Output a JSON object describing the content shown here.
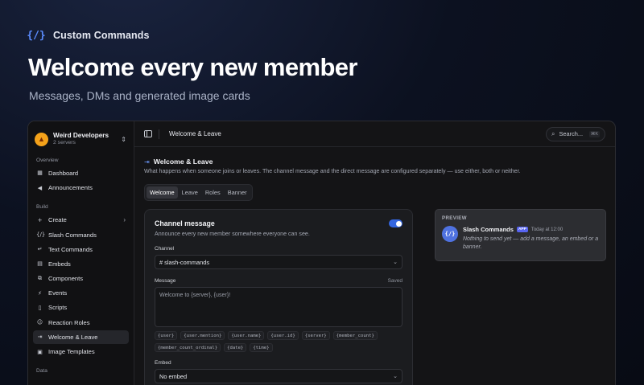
{
  "brand": {
    "name": "Custom Commands",
    "icon": "code-braces-icon"
  },
  "hero": {
    "title": "Welcome every new member",
    "subtitle": "Messages, DMs and generated image cards"
  },
  "workspace": {
    "name": "Weird Developers",
    "count": "2 servers"
  },
  "sidebar": {
    "overview_label": "Overview",
    "overview": [
      {
        "label": "Dashboard",
        "icon": "dashboard-icon"
      },
      {
        "label": "Announcements",
        "icon": "megaphone-icon"
      }
    ],
    "build_label": "Build",
    "build": [
      {
        "label": "Create",
        "icon": "plus-icon"
      },
      {
        "label": "Slash Commands",
        "icon": "slash-braces-icon"
      },
      {
        "label": "Text Commands",
        "icon": "text-command-icon"
      },
      {
        "label": "Embeds",
        "icon": "embed-icon"
      },
      {
        "label": "Components",
        "icon": "components-icon"
      },
      {
        "label": "Events",
        "icon": "bolt-icon"
      },
      {
        "label": "Scripts",
        "icon": "script-icon"
      },
      {
        "label": "Reaction Roles",
        "icon": "reaction-icon"
      },
      {
        "label": "Welcome & Leave",
        "icon": "welcome-icon"
      },
      {
        "label": "Image Templates",
        "icon": "image-icon"
      }
    ],
    "data_label": "Data"
  },
  "topbar": {
    "crumb": "Welcome & Leave",
    "search_placeholder": "Search...",
    "search_shortcut": "⌘K"
  },
  "page": {
    "title": "Welcome & Leave",
    "description": "What happens when someone joins or leaves. The channel message and the direct message are configured separately — use either, both or neither.",
    "tabs": [
      "Welcome",
      "Leave",
      "Roles",
      "Banner"
    ],
    "active_tab": "Welcome"
  },
  "channel_card": {
    "title": "Channel message",
    "enabled": true,
    "description": "Announce every new member somewhere everyone can see.",
    "channel_label": "Channel",
    "channel_value": "# slash-commands",
    "message_label": "Message",
    "message_status": "Saved",
    "message_value": "Welcome to {server}, {user}!",
    "variables": [
      "{user}",
      "{user.mention}",
      "{user.name}",
      "{user.id}",
      "{server}",
      "{member_count}",
      "{member_count_ordinal}",
      "{date}",
      "{time}"
    ],
    "embed_label": "Embed",
    "embed_value": "No embed"
  },
  "preview": {
    "label": "PREVIEW",
    "author": "Slash Commands",
    "badge": "APP",
    "time": "Today at 12:00",
    "text": "Nothing to send yet — add a message, an embed or a banner."
  },
  "colors": {
    "accent": "#3466e0",
    "brand": "#5b8cff",
    "badge": "#5865f2"
  }
}
